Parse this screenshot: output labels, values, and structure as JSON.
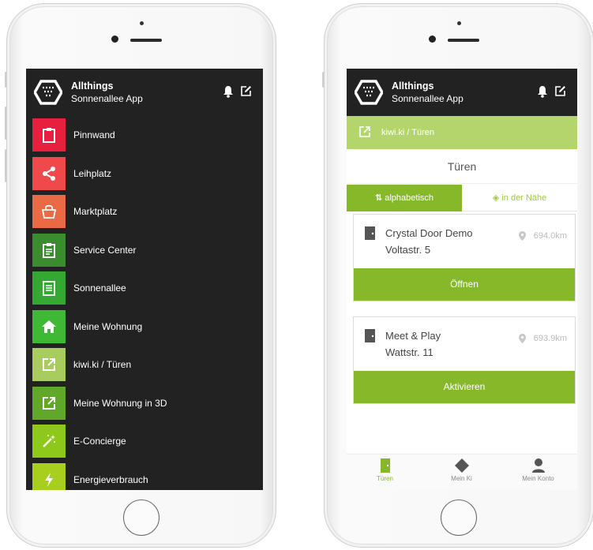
{
  "app": {
    "title": "Allthings",
    "subtitle": "Sonnenallee App"
  },
  "menu": {
    "items": [
      {
        "label": "Pinnwand",
        "icon": "clipboard-icon",
        "color": "#e8203f"
      },
      {
        "label": "Leihplatz",
        "icon": "share-icon",
        "color": "#f0494b"
      },
      {
        "label": "Marktplatz",
        "icon": "shopping-bag-icon",
        "color": "#ea6a45"
      },
      {
        "label": "Service Center",
        "icon": "clipboard-check-icon",
        "color": "#3a8c2e"
      },
      {
        "label": "Sonnenallee",
        "icon": "document-icon",
        "color": "#35a834"
      },
      {
        "label": "Meine Wohnung",
        "icon": "home-icon",
        "color": "#3fb935"
      },
      {
        "label": "kiwi.ki / Türen",
        "icon": "external-link-icon",
        "color": "#a9cc5f"
      },
      {
        "label": "Meine Wohnung in 3D",
        "icon": "external-link-icon",
        "color": "#61a82a"
      },
      {
        "label": "E-Concierge",
        "icon": "magic-wand-icon",
        "color": "#8ec81b"
      },
      {
        "label": "Energieverbrauch",
        "icon": "lightning-icon",
        "color": "#a8cf1d"
      }
    ]
  },
  "kiwi": {
    "section_title": "kiwi.ki / Türen",
    "page_title": "Türen",
    "tabs": {
      "alphabetical": "alphabetisch",
      "nearby": "in der Nähe"
    },
    "doors": [
      {
        "name": "Crystal Door Demo",
        "street": "Voltastr. 5",
        "distance": "694.0km",
        "action": "Öffnen"
      },
      {
        "name": "Meet & Play",
        "street": "Wattstr. 11",
        "distance": "693.9km",
        "action": "Aktivieren"
      }
    ]
  },
  "bottom_nav": {
    "doors": "Türen",
    "mein_ki": "Mein Ki",
    "mein_konto": "Mein Konto"
  },
  "colors": {
    "dark": "#222222",
    "green": "#86b82a",
    "light_green": "#b3d56b"
  }
}
